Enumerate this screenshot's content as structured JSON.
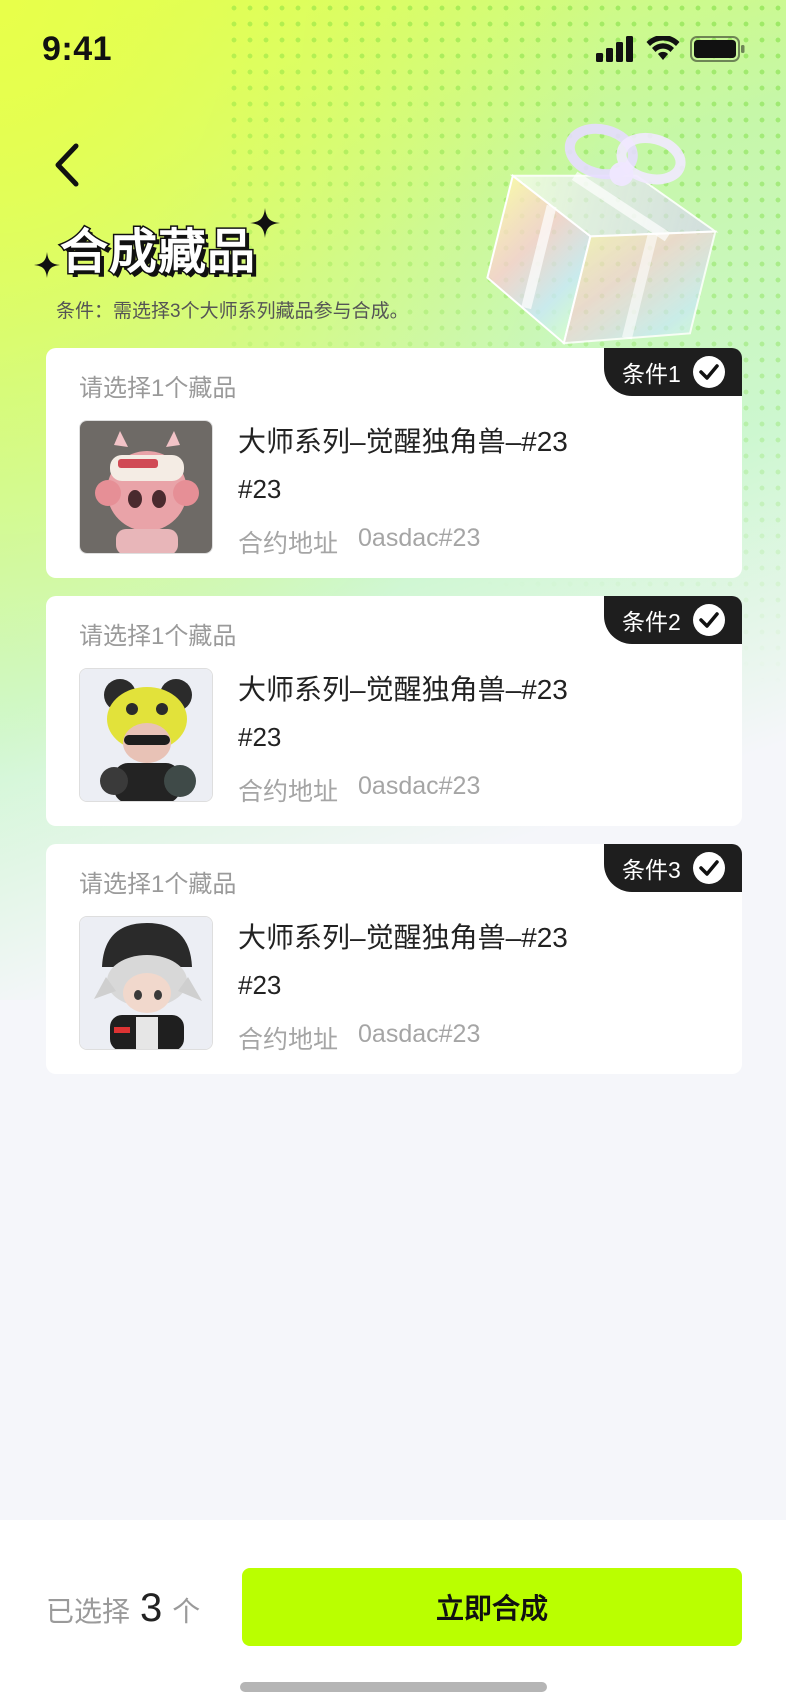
{
  "status_bar": {
    "time": "9:41"
  },
  "header": {
    "title": "合成藏品",
    "subtitle": "条件：需选择3个大师系列藏品参与合成。"
  },
  "cards": [
    {
      "prompt": "请选择1个藏品",
      "condition": "条件1",
      "name": "大师系列–觉醒独角兽–#23",
      "sub": "#23",
      "addr_label": "合约地址",
      "addr_value": "0asdac#23"
    },
    {
      "prompt": "请选择1个藏品",
      "condition": "条件2",
      "name": "大师系列–觉醒独角兽–#23",
      "sub": "#23",
      "addr_label": "合约地址",
      "addr_value": "0asdac#23"
    },
    {
      "prompt": "请选择1个藏品",
      "condition": "条件3",
      "name": "大师系列–觉醒独角兽–#23",
      "sub": "#23",
      "addr_label": "合约地址",
      "addr_value": "0asdac#23"
    }
  ],
  "footer": {
    "selected_prefix": "已选择",
    "selected_count": "3",
    "selected_suffix": "个",
    "button_label": "立即合成"
  },
  "colors": {
    "accent": "#baff00",
    "tag_bg": "#1e1e1e"
  }
}
